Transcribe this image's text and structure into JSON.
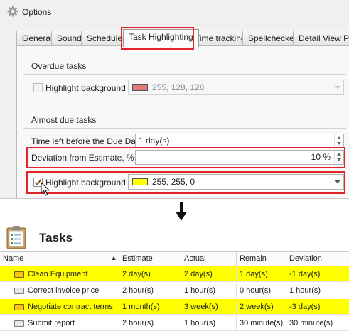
{
  "window": {
    "title": "Options"
  },
  "tabs": [
    "General",
    "Sound",
    "Scheduler",
    "Task Highlighting",
    "Time tracking",
    "Spellchecker",
    "Detail View Pan"
  ],
  "overdue": {
    "title": "Overdue tasks",
    "highlight_label": "Highlight background",
    "checked": false,
    "color": "#e27a7a",
    "color_text": "255, 128, 128"
  },
  "almost_due": {
    "title": "Almost due tasks",
    "time_left_label": "Time left before the Due Date",
    "time_left_value": "1 day(s)",
    "deviation_label": "Deviation from Estimate, %",
    "deviation_value": "10 %",
    "highlight_label": "Highlight background",
    "checked": true,
    "color": "#ffff00",
    "color_text": "255, 255, 0"
  },
  "tasks": {
    "title": "Tasks",
    "columns": [
      "Name",
      "Estimate",
      "Actual",
      "Remain",
      "Deviation"
    ],
    "rows": [
      {
        "name": "Clean Equipment",
        "estimate": "2 day(s)",
        "actual": "2 day(s)",
        "remain": "1 day(s)",
        "deviation": "-1 day(s)",
        "highlighted": true
      },
      {
        "name": "Correct invoice price",
        "estimate": "2 hour(s)",
        "actual": "1 hour(s)",
        "remain": "0 hour(s)",
        "deviation": "1 hour(s)",
        "highlighted": false
      },
      {
        "name": "Negotiate contract terms",
        "estimate": "1 month(s)",
        "actual": "3 week(s)",
        "remain": "2 week(s)",
        "deviation": "-3 day(s)",
        "highlighted": true
      },
      {
        "name": "Submit report",
        "estimate": "2 hour(s)",
        "actual": "1 hour(s)",
        "remain": "30 minute(s)",
        "deviation": "30 minute(s)",
        "highlighted": false
      }
    ]
  },
  "colors": {
    "callout": "#e2232a",
    "highlight": "#ffff00"
  }
}
